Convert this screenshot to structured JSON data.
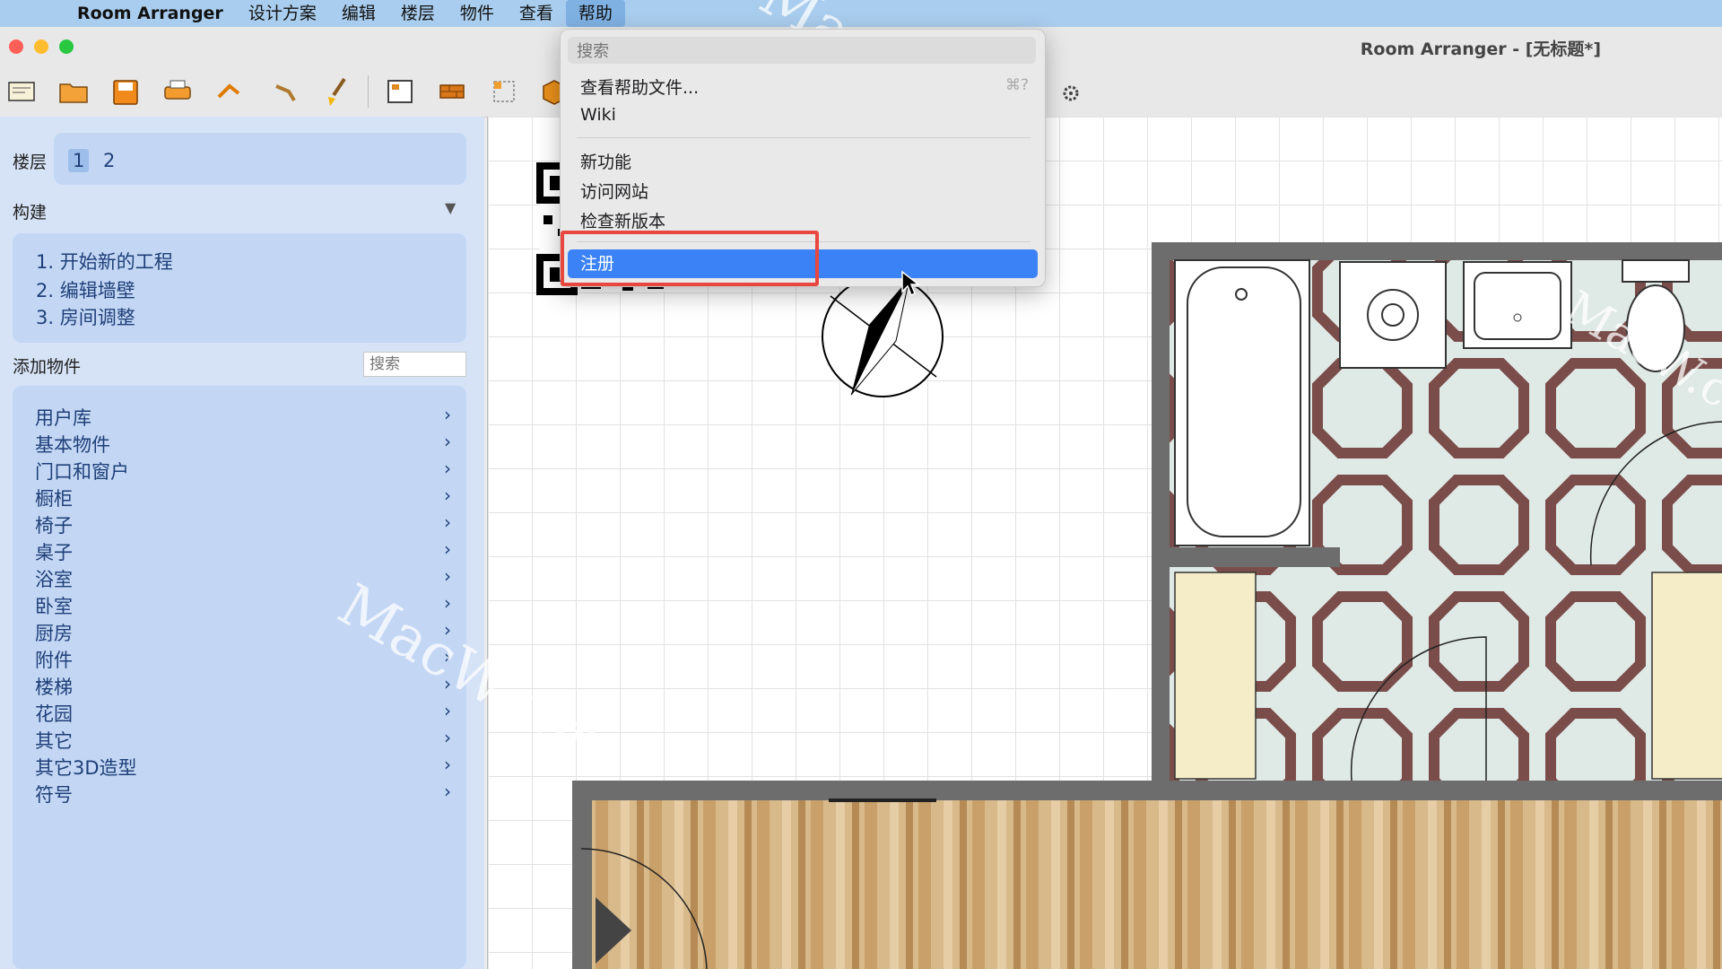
{
  "menubar": {
    "app_name": "Room Arranger",
    "items": [
      "设计方案",
      "编辑",
      "楼层",
      "物件",
      "查看",
      "帮助"
    ],
    "open_menu": "帮助"
  },
  "window": {
    "title": "Room Arranger - [无标题*]"
  },
  "help_menu": {
    "search_placeholder": "搜索",
    "items": {
      "help_file": "查看帮助文件...",
      "help_file_shortcut": "⌘?",
      "wiki": "Wiki",
      "whats_new": "新功能",
      "visit_site": "访问网站",
      "check_update": "检查新版本",
      "register": "注册"
    },
    "highlighted_item": "注册"
  },
  "sidebar": {
    "floors_label": "楼层",
    "floors": [
      "1",
      "2"
    ],
    "selected_floor": "1",
    "build_label": "构建",
    "build_steps": [
      "1. 开始新的工程",
      "2. 编辑墙壁",
      "3. 房间调整"
    ],
    "add_objects_label": "添加物件",
    "search_placeholder": "搜索",
    "categories": [
      "用户库",
      "基本物件",
      "门口和窗户",
      "橱柜",
      "椅子",
      "桌子",
      "浴室",
      "卧室",
      "厨房",
      "附件",
      "楼梯",
      "花园",
      "其它",
      "其它3D造型",
      "符号"
    ]
  },
  "watermark": "MacW.com",
  "colors": {
    "menubar_bg": "#a9cdee",
    "sidebar_bg": "#d6e3f6",
    "accent_blue": "#3b82f6",
    "highlight_red": "#e8473f"
  }
}
